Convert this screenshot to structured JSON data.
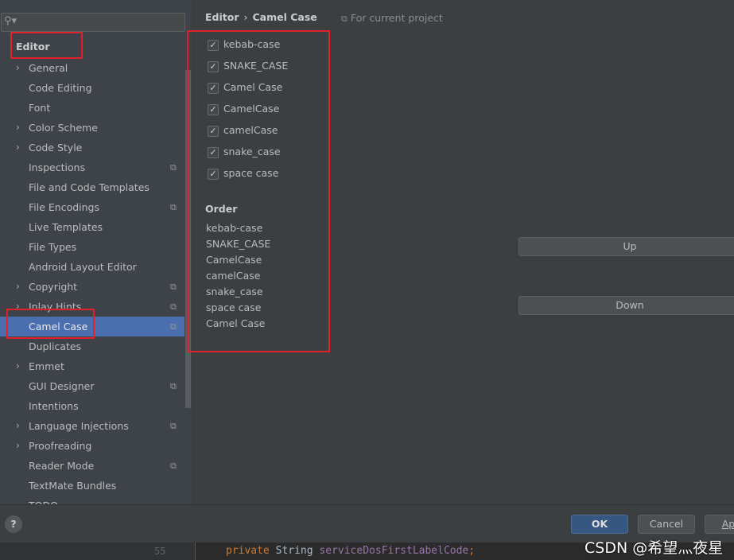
{
  "sidebar": {
    "search_placeholder": "",
    "section": "Editor",
    "items": [
      {
        "label": "General",
        "arrow": true,
        "project": false
      },
      {
        "label": "Code Editing",
        "arrow": false,
        "project": false
      },
      {
        "label": "Font",
        "arrow": false,
        "project": false
      },
      {
        "label": "Color Scheme",
        "arrow": true,
        "project": false
      },
      {
        "label": "Code Style",
        "arrow": true,
        "project": false
      },
      {
        "label": "Inspections",
        "arrow": false,
        "project": true
      },
      {
        "label": "File and Code Templates",
        "arrow": false,
        "project": false
      },
      {
        "label": "File Encodings",
        "arrow": false,
        "project": true
      },
      {
        "label": "Live Templates",
        "arrow": false,
        "project": false
      },
      {
        "label": "File Types",
        "arrow": false,
        "project": false
      },
      {
        "label": "Android Layout Editor",
        "arrow": false,
        "project": false
      },
      {
        "label": "Copyright",
        "arrow": true,
        "project": true
      },
      {
        "label": "Inlay Hints",
        "arrow": true,
        "project": true
      },
      {
        "label": "Camel Case",
        "arrow": false,
        "project": true,
        "selected": true
      },
      {
        "label": "Duplicates",
        "arrow": false,
        "project": false
      },
      {
        "label": "Emmet",
        "arrow": true,
        "project": false
      },
      {
        "label": "GUI Designer",
        "arrow": false,
        "project": true
      },
      {
        "label": "Intentions",
        "arrow": false,
        "project": false
      },
      {
        "label": "Language Injections",
        "arrow": true,
        "project": true
      },
      {
        "label": "Proofreading",
        "arrow": true,
        "project": false
      },
      {
        "label": "Reader Mode",
        "arrow": false,
        "project": true
      },
      {
        "label": "TextMate Bundles",
        "arrow": false,
        "project": false
      },
      {
        "label": "TODO",
        "arrow": false,
        "project": false
      }
    ]
  },
  "breadcrumb": {
    "parent": "Editor",
    "separator": "›",
    "current": "Camel Case"
  },
  "for_project": "For current project",
  "checkboxes": [
    {
      "label": "kebab-case",
      "checked": true
    },
    {
      "label": "SNAKE_CASE",
      "checked": true
    },
    {
      "label": "Camel Case",
      "checked": true
    },
    {
      "label": "CamelCase",
      "checked": true
    },
    {
      "label": "camelCase",
      "checked": true
    },
    {
      "label": "snake_case",
      "checked": true
    },
    {
      "label": "space case",
      "checked": true
    }
  ],
  "order": {
    "title": "Order",
    "items": [
      "kebab-case",
      "SNAKE_CASE",
      "CamelCase",
      "camelCase",
      "snake_case",
      "space case",
      "Camel Case"
    ]
  },
  "buttons": {
    "up": "Up",
    "down": "Down",
    "ok": "OK",
    "cancel": "Cancel",
    "apply": "Ap",
    "help": "?"
  },
  "code": {
    "line": "55",
    "kw": "private",
    "type": "String",
    "field": "serviceDosFirstLabelCode",
    "end": ";"
  },
  "watermark": "CSDN @希望灬夜星",
  "colors": {
    "selection": "#4b6eaf",
    "highlight_box": "#e0202a",
    "ok_button": "#365880"
  }
}
